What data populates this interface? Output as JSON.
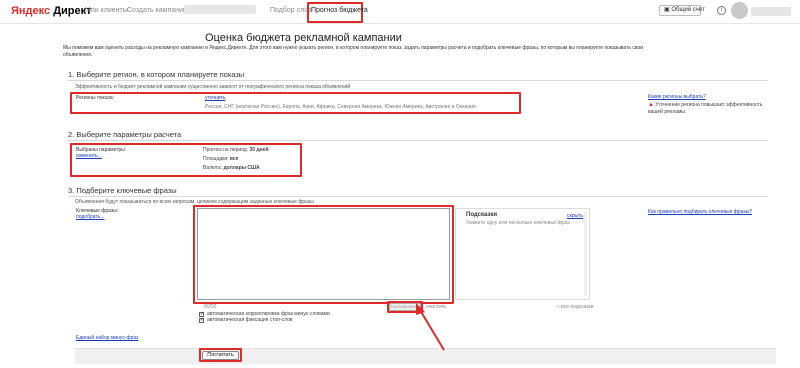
{
  "header": {
    "logo_brand": "Яндекс",
    "logo_product": "Директ",
    "nav": [
      "Мои клиенты",
      "Создать кампанию",
      "Подбор слов",
      "Прогноз бюджета"
    ],
    "account_button": "Общий счёт",
    "help_icon": "info-icon",
    "settings_icon": "gear-icon"
  },
  "page": {
    "title": "Оценка бюджета рекламной кампании",
    "intro": "Мы поможем вам оценить расходы на рекламную кампанию в Яндекс.Директе. Для этого вам нужно указать регион, в котором планируете показ, задать параметры расчета и подобрать ключевые фразы, по которым вы планируете показывать свои объявления."
  },
  "section1": {
    "title": "1. Выберите регион, в котором планируете показы",
    "note": "Эффективность и бюджет рекламной кампании существенно зависят от географического региона показа объявлений",
    "regions_label": "Регионы показа:",
    "regions_edit": "уточнить",
    "regions_value": "Россия, СНГ (исключая Россию), Европа, Азия, Африка, Северная Америка, Южная Америка, Австралия и Океания",
    "help_link": "Какие регионы выбрать?",
    "warning": "Уточнение региона повышает эффективность вашей рекламы."
  },
  "section2": {
    "title": "2. Выберите параметры расчета",
    "selected_label": "Выбраны параметры",
    "change_link": "изменить...",
    "period_label": "Прогноз на период:",
    "period_value": "30 дней",
    "platforms_label": "Площадки:",
    "platforms_value": "все",
    "currency_label": "Валюта:",
    "currency_value": "доллары США"
  },
  "section3": {
    "title": "3. Подберите ключевые фразы",
    "note": "Объявления будут показываться по всем запросам, целиком содержащим заданные ключевые фразы",
    "keywords_label": "Ключевые фразы:",
    "pick_link": "подобрать...",
    "hints_title": "Подсказки",
    "hints_hide": "скрыть",
    "hints_placeholder": "Укажите одну или несколько ключевых фраз",
    "help_link": "Как правильно подбирать ключевые фразы?",
    "counter": "0/255",
    "group_button": "Группировать",
    "clear_link": "очистить",
    "all_link": "« все подсказки",
    "checkbox1": "автоматическая корректировка фраз минус-словами",
    "checkbox2": "автоматическая фиксация стоп-слов",
    "minus_link": "Единый набор минус-фраз",
    "calc_button": "Посчитать"
  }
}
